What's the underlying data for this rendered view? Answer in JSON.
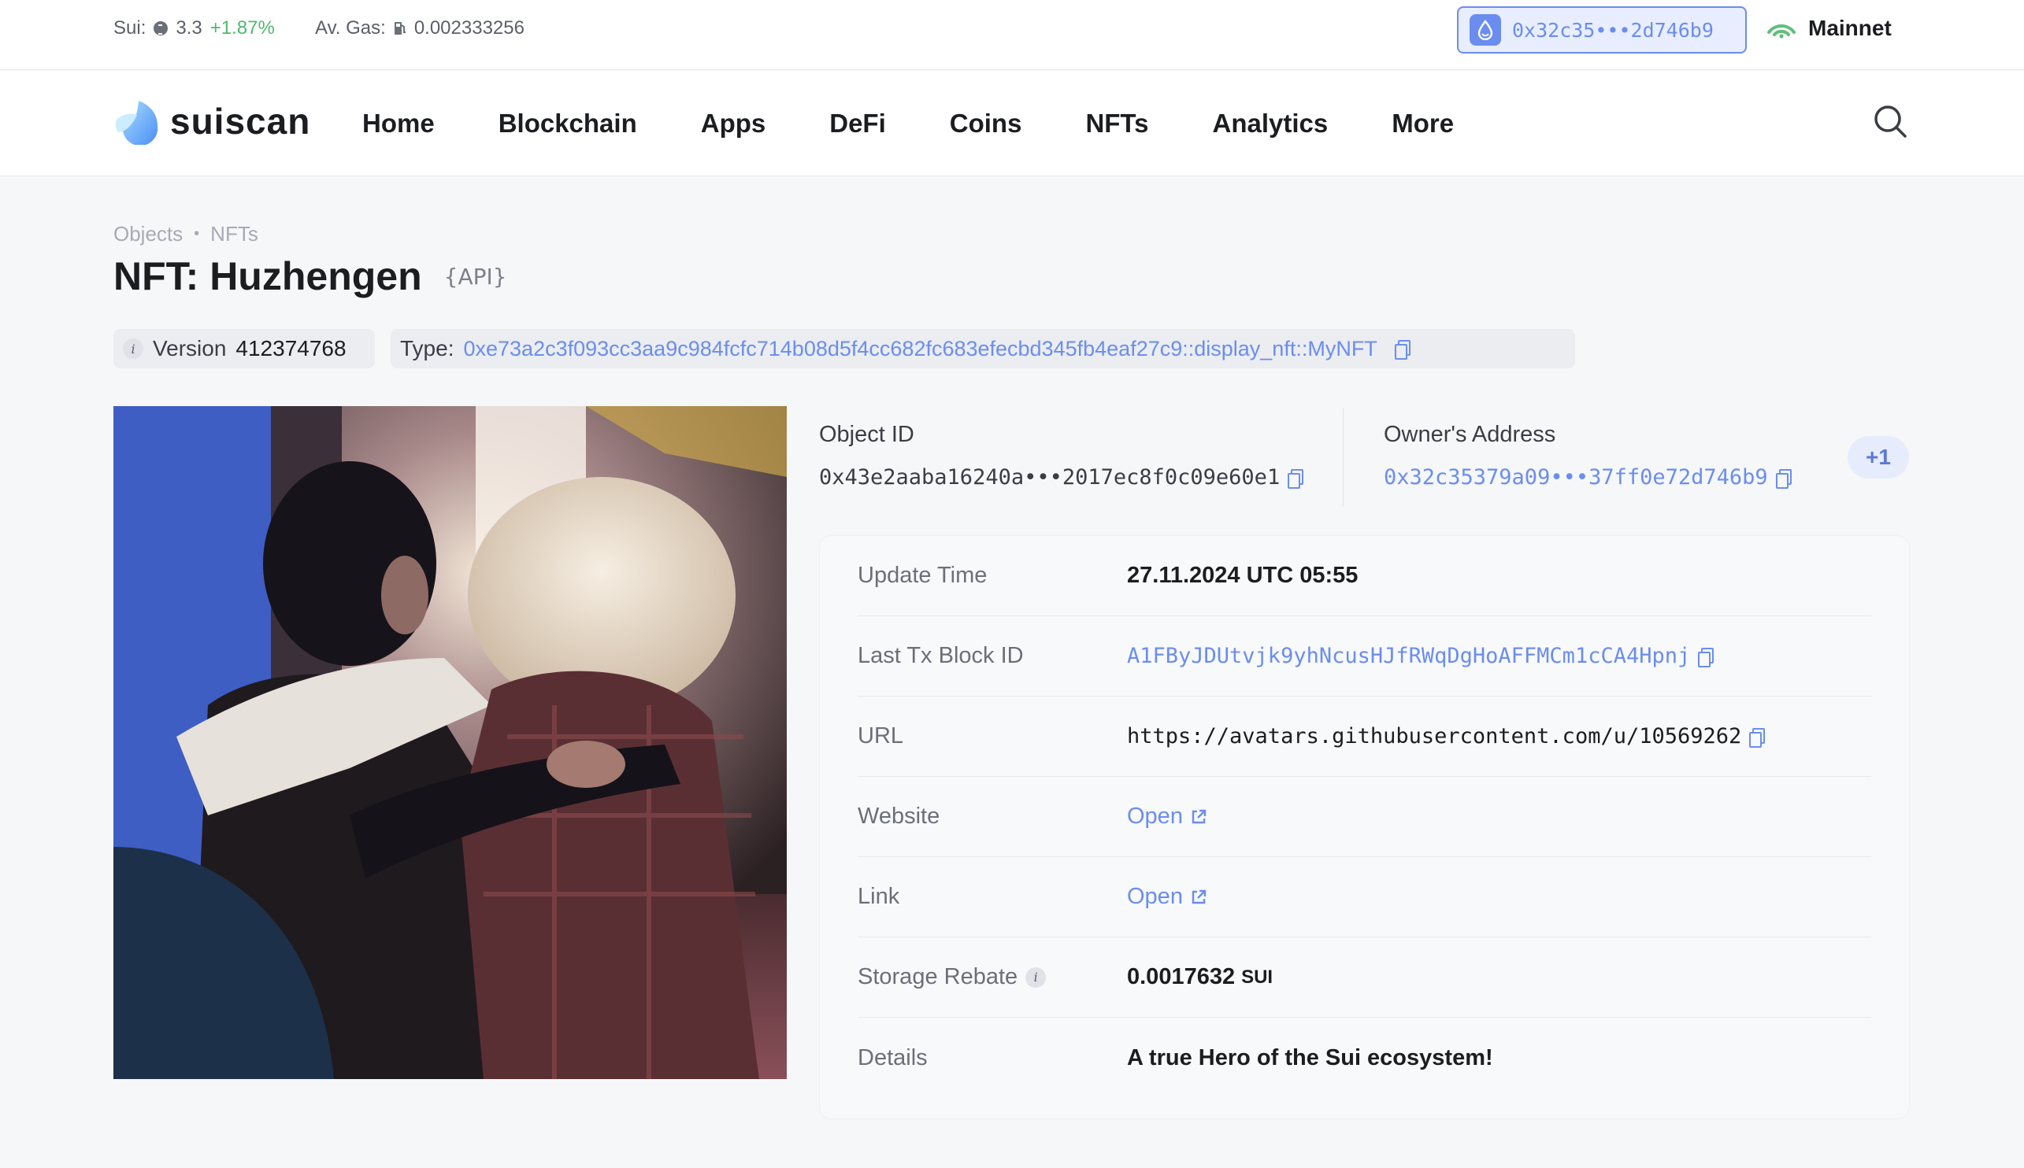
{
  "ticker": {
    "sui_label": "Sui:",
    "sui_price": "3.3",
    "sui_change": "+1.87%",
    "gas_label": "Av. Gas:",
    "gas_value": "0.002333256",
    "wallet_address": "0x32c35•••2d746b9",
    "network": "Mainnet"
  },
  "nav": {
    "brand": "suiscan",
    "items": [
      "Home",
      "Blockchain",
      "Apps",
      "DeFi",
      "Coins",
      "NFTs",
      "Analytics",
      "More"
    ]
  },
  "breadcrumb": [
    "Objects",
    "NFTs"
  ],
  "breadcrumb_separator": "•",
  "page": {
    "title": "NFT: Huzhengen",
    "api_label": "{API}",
    "version_label": "Version",
    "version_value": "412374768",
    "type_label": "Type:",
    "type_value": "0xe73a2c3f093cc3aa9c984fcfc714b08d5f4cc682fc683efecbd345fb4eaf27c9::display_nft::MyNFT"
  },
  "object": {
    "object_id_label": "Object ID",
    "object_id": "0x43e2aaba16240a•••2017ec8f0c09e60e1",
    "owner_label": "Owner's Address",
    "owner_address": "0x32c35379a09•••37ff0e72d746b9",
    "owner_extra": "+1"
  },
  "details": {
    "update_time_label": "Update Time",
    "update_time": "27.11.2024 UTC 05:55",
    "last_tx_label": "Last Tx Block ID",
    "last_tx": "A1FByJDUtvjk9yhNcusHJfRWqDgHoAFFMCm1cCA4Hpnj",
    "url_label": "URL",
    "url": "https://avatars.githubusercontent.com/u/10569262",
    "website_label": "Website",
    "website": "Open",
    "link_label": "Link",
    "link": "Open",
    "storage_label": "Storage Rebate",
    "storage_value": "0.0017632",
    "storage_unit": "SUI",
    "details_label": "Details",
    "details": "A true Hero of the Sui ecosystem!"
  },
  "colors": {
    "accent": "#6b8df0",
    "positive": "#4fb96f",
    "network": "#5fbf7a"
  }
}
